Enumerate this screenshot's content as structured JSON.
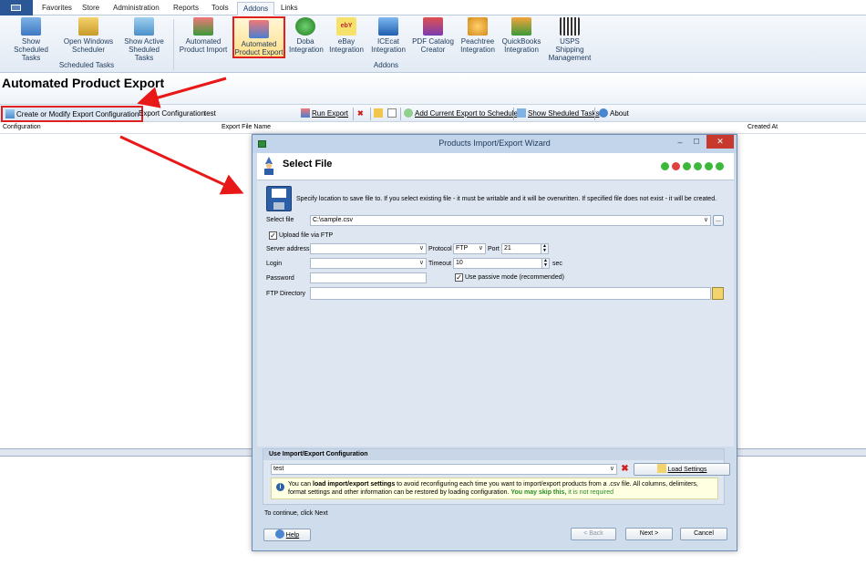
{
  "ribbon_tabs": [
    "Favorites",
    "Store",
    "Administration",
    "Reports",
    "Tools",
    "Addons",
    "Links"
  ],
  "active_tab": "Addons",
  "ribbon_buttons": {
    "show_scheduled_tasks": "Show Scheduled Tasks",
    "open_windows_scheduler": "Open Windows Scheduler",
    "show_active_scheduled_tasks": "Show Active Sheduled Tasks",
    "automated_product_import": "Automated Product Import",
    "automated_product_export": "Automated Product Export",
    "doba_integration": "Doba Integration",
    "ebay_integration": "eBay Integration",
    "icecat_integration": "ICEcat Integration",
    "pdf_catalog_creator": "PDF Catalog Creator",
    "peachtree_integration": "Peachtree Integration",
    "quickbooks_integration": "QuickBooks Integration",
    "usps_shipping_management": "USPS Shipping Management"
  },
  "ribbon_groups": {
    "scheduled_tasks": "Scheduled Tasks",
    "addons": "Addons"
  },
  "page_title": "Automated Product Export",
  "toolbar": {
    "create_config": "Create or Modify Export Configuration",
    "export_config_label": "Export Configuration",
    "export_config_value": "test",
    "run_export": "Run Export",
    "add_to_scheduler": "Add Current Export to Scheduler",
    "show_scheduled_tasks": "Show Sheduled Tasks",
    "about": "About"
  },
  "grid_columns": {
    "configuration": "Configuration",
    "export_file_name": "Export File Name",
    "created_at": "Created At"
  },
  "wizard": {
    "title": "Products Import/Export Wizard",
    "step_title": "Select File",
    "intro": "Specify location to save file to. If you select existing file - it must be writable and it will be overwritten. If specified file does not exist - it will be created.",
    "select_file_label": "Select file",
    "select_file_value": "C:\\sample.csv",
    "browse": "...",
    "upload_ftp_label": "Upload file via FTP",
    "upload_ftp_checked": true,
    "server_address_label": "Server address",
    "server_address_value": "",
    "protocol_label": "Protocol",
    "protocol_value": "FTP",
    "port_label": "Port",
    "port_value": "21",
    "login_label": "Login",
    "login_value": "",
    "timeout_label": "Timeout",
    "timeout_value": "10",
    "timeout_unit": "sec",
    "password_label": "Password",
    "password_value": "",
    "passive_mode_label": "Use passive mode (recommended)",
    "passive_mode_checked": true,
    "ftp_directory_label": "FTP Directory",
    "ftp_directory_value": "",
    "step_dots": [
      "#3db83d",
      "#e04040",
      "#3db83d",
      "#3db83d",
      "#3db83d",
      "#3db83d"
    ],
    "config_section_title": "Use Import/Export Configuration",
    "config_value": "test",
    "load_settings": "Load Settings",
    "info_part1": "You can ",
    "info_bold": "load import/export settings",
    "info_part2": " to avoid reconfiguring each time you want to import/export products from a .csv file. All columns, delimiters, format settings and other information can be restored by loading configuration. ",
    "info_green_bold": "You may skip this,",
    "info_green": " it is not required",
    "continue_hint": "To continue, click Next",
    "help": "Help",
    "back": "< Back",
    "next": "Next >",
    "cancel": "Cancel"
  }
}
